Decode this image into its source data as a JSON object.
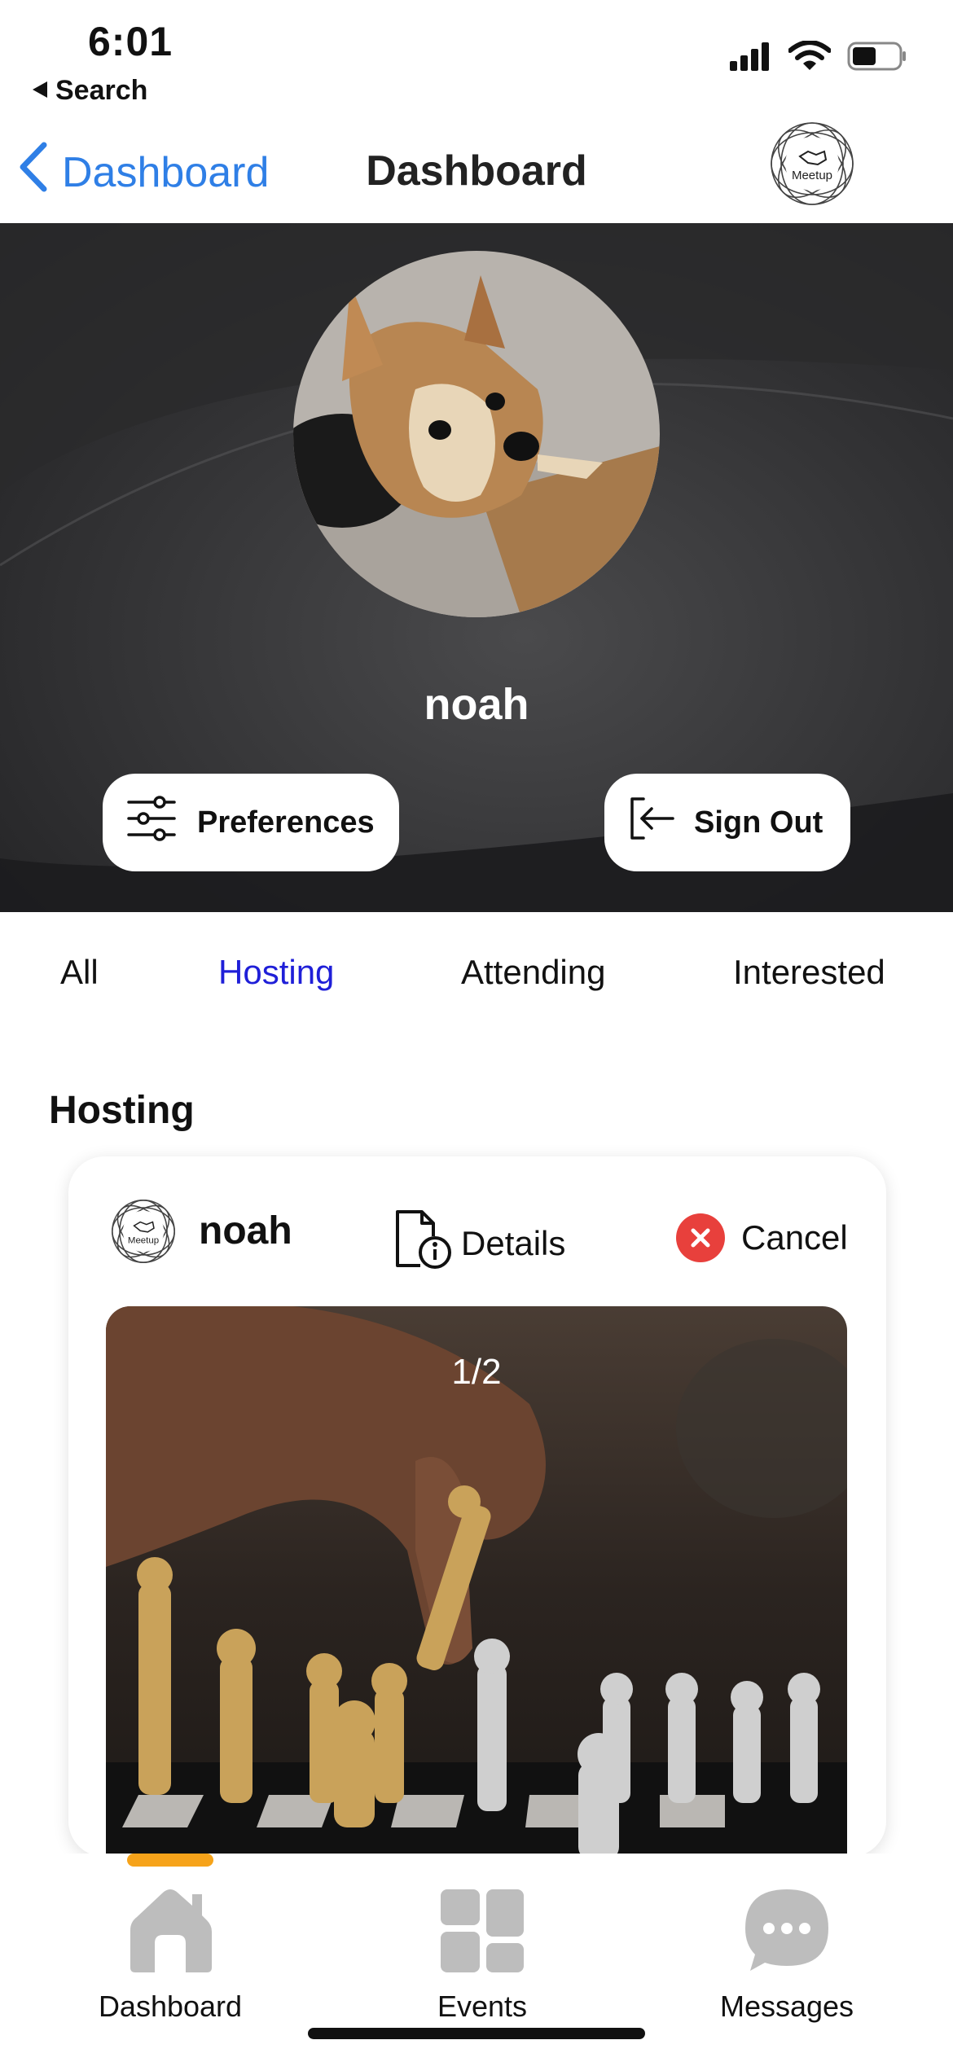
{
  "status_bar": {
    "time": "6:01",
    "back_label": "Search"
  },
  "nav": {
    "back_label": "Dashboard",
    "title": "Dashboard",
    "logo_text": "Meetup"
  },
  "profile": {
    "name": "noah",
    "preferences_label": "Preferences",
    "sign_out_label": "Sign Out"
  },
  "filter_tabs": [
    {
      "label": "All"
    },
    {
      "label": "Hosting",
      "active": true
    },
    {
      "label": "Attending"
    },
    {
      "label": "Interested"
    }
  ],
  "section": {
    "title": "Hosting"
  },
  "event_card": {
    "logo_text": "Meetup",
    "host": "noah",
    "details_label": "Details",
    "cancel_label": "Cancel",
    "photo_counter": "1/2"
  },
  "tab_bar": {
    "items": [
      {
        "label": "Dashboard",
        "icon": "home-icon",
        "active": true
      },
      {
        "label": "Events",
        "icon": "grid-icon"
      },
      {
        "label": "Messages",
        "icon": "chat-bubble-icon"
      }
    ]
  },
  "colors": {
    "link_blue": "#2f7fe6",
    "active_tab": "#1f1fd8",
    "hero_bg": "#2b2b2d",
    "cancel_red": "#e8403c",
    "tab_indicator": "#f6a31a",
    "tab_icon_gray": "#bdbdbd"
  }
}
